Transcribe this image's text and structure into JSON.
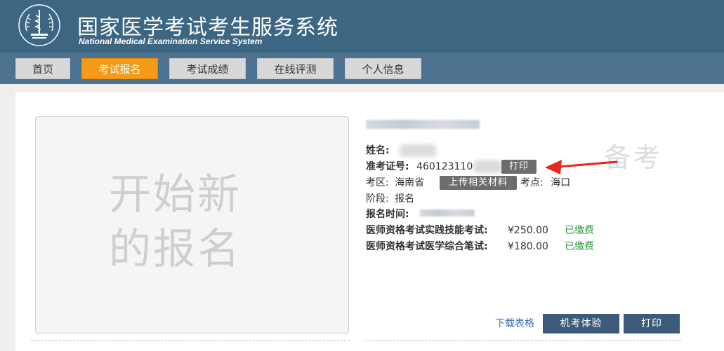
{
  "header": {
    "title_cn": "国家医学考试考生服务系统",
    "title_en": "National Medical Examination Service System"
  },
  "nav": {
    "items": [
      {
        "label": "首页",
        "active": false
      },
      {
        "label": "考试报名",
        "active": true
      },
      {
        "label": "考试成绩",
        "active": false
      },
      {
        "label": "在线评测",
        "active": false
      },
      {
        "label": "个人信息",
        "active": false
      }
    ]
  },
  "card": {
    "placeholder_text": "开始新的报名",
    "watermark": "备考",
    "fields": {
      "name_label": "姓名:",
      "ticket_label": "准考证号:",
      "ticket_value": "460123110",
      "print_tag": "打印",
      "region_label": "考区:",
      "region_value": "海南省",
      "upload_tag": "上传相关材料",
      "site_label": "考点:",
      "site_value": "海口",
      "stage_label": "阶段:",
      "stage_value": "报名",
      "reg_time_label": "报名时间:"
    },
    "fees": [
      {
        "name": "医师资格考试实践技能考试:",
        "amount": "¥250.00",
        "status": "已缴费"
      },
      {
        "name": "医师资格考试医学综合笔试:",
        "amount": "¥180.00",
        "status": "已缴费"
      }
    ],
    "actions": {
      "download_label": "下载表格",
      "exam_trial_label": "机考体验",
      "print_label": "打印"
    }
  },
  "colors": {
    "header_bg": "#3d6682",
    "nav_bg": "#4e7390",
    "active_tab": "#f59b17",
    "paid_green": "#2e9b3c",
    "action_button": "#3c5a7a",
    "arrow_red": "#e8261d"
  }
}
